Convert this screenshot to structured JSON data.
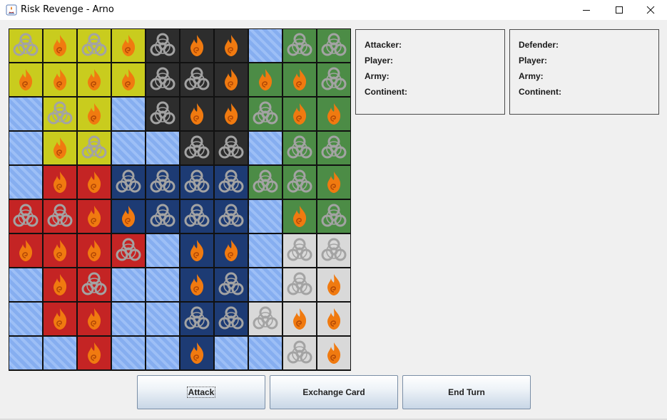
{
  "window": {
    "title": "Risk Revenge - Arno",
    "controls": [
      "minimize-icon",
      "maximize-icon",
      "close-icon"
    ]
  },
  "colors": {
    "yellow": "#c9cc1e",
    "black": "#2d2d2d",
    "green": "#4c8c46",
    "red": "#c42424",
    "blue": "#1d3b74",
    "white": "#d9d9d9",
    "water": "#86aef0",
    "bio_symbol": "#a3a3a3",
    "fire_symbol": "#f07a10"
  },
  "board": {
    "cols": 10,
    "rows": 10,
    "tiles": [
      [
        "yellow:bio",
        "yellow:fire",
        "yellow:bio",
        "yellow:fire",
        "black:bio",
        "black:fire",
        "black:fire",
        "water",
        "green:bio",
        "green:bio"
      ],
      [
        "yellow:fire",
        "yellow:fire",
        "yellow:fire",
        "yellow:fire",
        "black:bio",
        "black:bio",
        "black:fire",
        "green:fire",
        "green:fire",
        "green:bio"
      ],
      [
        "water",
        "yellow:bio",
        "yellow:fire",
        "water",
        "black:bio",
        "black:fire",
        "black:fire",
        "green:bio",
        "green:fire",
        "green:fire"
      ],
      [
        "water",
        "yellow:fire",
        "yellow:bio",
        "water",
        "water",
        "black:bio",
        "black:bio",
        "water",
        "green:bio",
        "green:bio"
      ],
      [
        "water",
        "red:fire",
        "red:fire",
        "blue:bio",
        "blue:bio",
        "blue:bio",
        "blue:bio",
        "green:bio",
        "green:bio",
        "green:fire"
      ],
      [
        "red:bio",
        "red:bio",
        "red:fire",
        "blue:fire",
        "blue:bio",
        "blue:bio",
        "blue:bio",
        "water",
        "green:fire",
        "green:bio"
      ],
      [
        "red:fire",
        "red:fire",
        "red:fire",
        "red:bio",
        "water",
        "blue:fire",
        "blue:fire",
        "water",
        "white:bio",
        "white:bio"
      ],
      [
        "water",
        "red:fire",
        "red:bio",
        "water",
        "water",
        "blue:fire",
        "blue:bio",
        "water",
        "white:bio",
        "white:fire"
      ],
      [
        "water",
        "red:fire",
        "red:fire",
        "water",
        "water",
        "blue:bio",
        "blue:bio",
        "white:bio",
        "white:fire",
        "white:fire"
      ],
      [
        "water",
        "water",
        "red:fire",
        "water",
        "water",
        "blue:fire",
        "water",
        "water",
        "white:bio",
        "white:fire"
      ]
    ]
  },
  "attacker_panel": {
    "heading": "Attacker:",
    "player_label": "Player:",
    "army_label": "Army:",
    "continent_label": "Continent:"
  },
  "defender_panel": {
    "heading": "Defender:",
    "player_label": "Player:",
    "army_label": "Army:",
    "continent_label": "Continent:"
  },
  "buttons": {
    "attack": "Attack",
    "exchange": "Exchange Card",
    "end_turn": "End Turn"
  }
}
